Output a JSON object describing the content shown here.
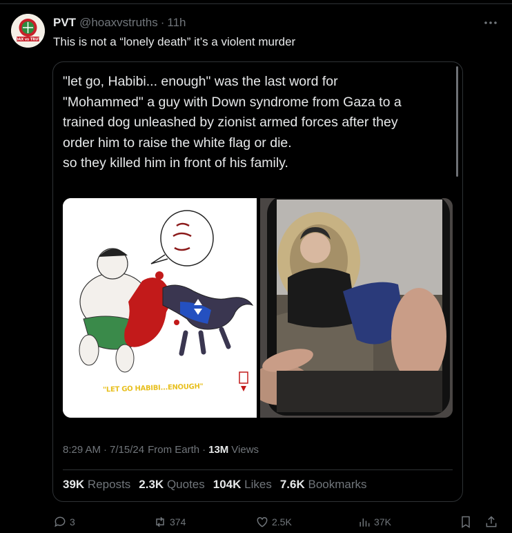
{
  "tweet": {
    "author_name": "PVT",
    "author_handle": "@hoaxvstruths",
    "separator": "·",
    "time_ago": "11h",
    "text": "This is not a “lonely death” it’s a violent murder",
    "avatar_logo_text": "HOAX vs TRUTH"
  },
  "quote": {
    "lines": [
      "\"let go, Habibi... enough\" was the last word for",
      "\"Mohammed\" a guy with Down syndrome from Gaza to a",
      "trained dog unleashed by zionist armed forces after they",
      "order him to raise the white flag or die.",
      "so they killed him in front of his family."
    ],
    "image_caption": "\"LET GO HABIBI...ENOUGH\"",
    "meta": {
      "time": "8:29 AM",
      "date": "7/15/24",
      "location": "From Earth",
      "views_count": "13M",
      "views_label": "Views"
    },
    "stats": [
      {
        "count": "39K",
        "label": "Reposts"
      },
      {
        "count": "2.3K",
        "label": "Quotes"
      },
      {
        "count": "104K",
        "label": "Likes"
      },
      {
        "count": "7.6K",
        "label": "Bookmarks"
      }
    ]
  },
  "actions": {
    "replies": "3",
    "reposts": "374",
    "likes": "2.5K",
    "views": "37K"
  },
  "colors": {
    "background": "#000000",
    "text_primary": "#e7e9ea",
    "text_secondary": "#71767b",
    "border": "#2f3336",
    "caption_yellow": "#e8c020"
  },
  "icons": [
    "more-icon",
    "reply-icon",
    "repost-icon",
    "like-icon",
    "views-icon",
    "bookmark-icon",
    "share-icon"
  ]
}
